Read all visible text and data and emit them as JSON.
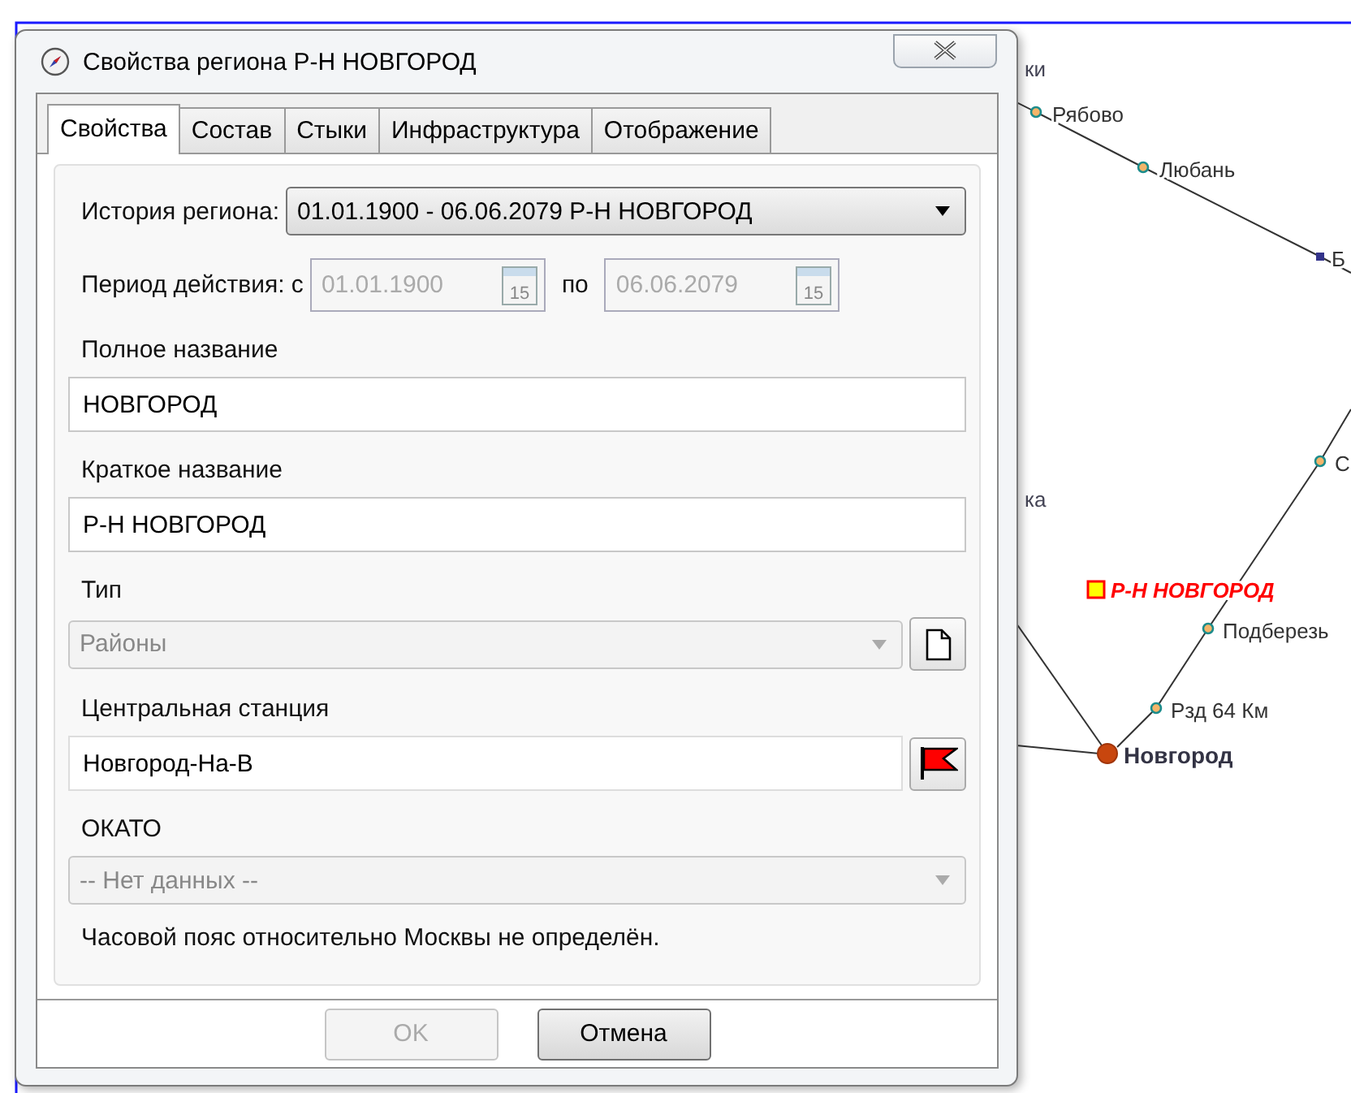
{
  "map": {
    "labels": [
      {
        "text": "ки",
        "kind": "fragment"
      },
      {
        "text": "Рябово",
        "kind": "stop"
      },
      {
        "text": "Любань",
        "kind": "stop"
      },
      {
        "text": "Б",
        "kind": "junction"
      },
      {
        "text": "С",
        "kind": "stop"
      },
      {
        "text": "ка",
        "kind": "fragment"
      },
      {
        "text": "Р-Н НОВГОРОД",
        "kind": "region"
      },
      {
        "text": "Подберезь",
        "kind": "stop"
      },
      {
        "text": "Рзд 64 Км",
        "kind": "stop"
      },
      {
        "text": "Новгород",
        "kind": "major"
      }
    ]
  },
  "window": {
    "title": "Свойства региона Р-Н НОВГОРОД"
  },
  "tabs": [
    {
      "label": "Свойства",
      "selected": true
    },
    {
      "label": "Состав",
      "selected": false
    },
    {
      "label": "Стыки",
      "selected": false
    },
    {
      "label": "Инфраструктура",
      "selected": false
    },
    {
      "label": "Отображение",
      "selected": false
    }
  ],
  "history": {
    "label": "История региона:",
    "value": "01.01.1900 - 06.06.2079 Р-Н НОВГОРОД",
    "disabled": false
  },
  "period": {
    "label": "Период действия: с",
    "separator": "по",
    "from": {
      "value": "01.01.1900",
      "disabled": true,
      "icon_text": "15"
    },
    "to": {
      "value": "06.06.2079",
      "disabled": true,
      "icon_text": "15"
    }
  },
  "full_name": {
    "label": "Полное название",
    "value": "НОВГОРОД"
  },
  "short_name": {
    "label": "Краткое название",
    "value": "Р-Н НОВГОРОД"
  },
  "type": {
    "label": "Тип",
    "value": "Районы",
    "disabled": true
  },
  "central_station": {
    "label": "Центральная станция",
    "value": "Новгород-На-В"
  },
  "okato": {
    "label": "ОКАТО",
    "value": "-- Нет данных --",
    "disabled": true
  },
  "note": "Часовой пояс относительно Москвы не определён.",
  "buttons": [
    {
      "label": "OK",
      "disabled": true
    },
    {
      "label": "Отмена",
      "disabled": false
    }
  ]
}
